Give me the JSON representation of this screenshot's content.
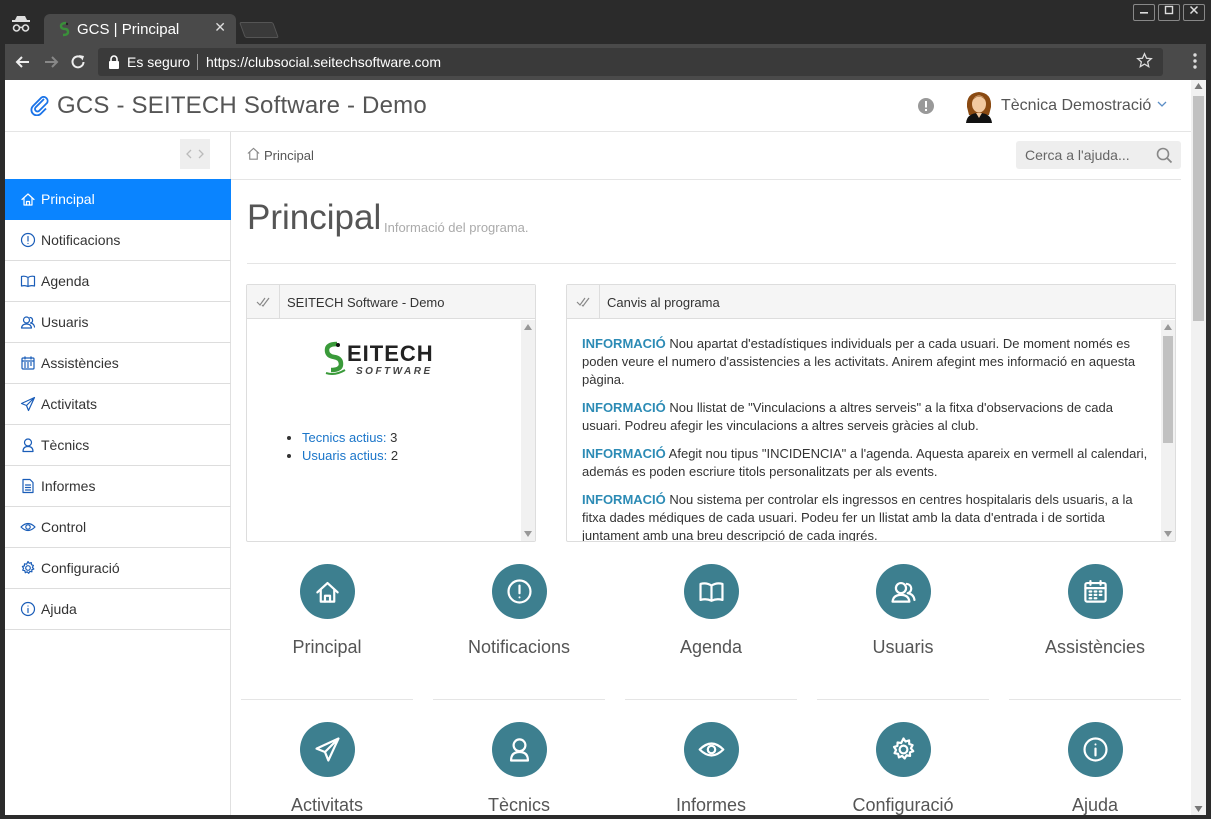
{
  "browser": {
    "tab_title": "GCS | Principal",
    "tab_close": "✕",
    "secure_label": "Es seguro",
    "url": "https://clubsocial.seitechsoftware.com"
  },
  "header": {
    "brand": "GCS - SEITECH Software - Demo",
    "user_name": "Tècnica Demostració"
  },
  "sidebar": {
    "items": [
      {
        "label": "Principal",
        "icon": "home-icon",
        "active": true
      },
      {
        "label": "Notificacions",
        "icon": "alert-icon"
      },
      {
        "label": "Agenda",
        "icon": "book-icon"
      },
      {
        "label": "Usuaris",
        "icon": "users-icon"
      },
      {
        "label": "Assistències",
        "icon": "calendar-icon"
      },
      {
        "label": "Activitats",
        "icon": "send-icon"
      },
      {
        "label": "Tècnics",
        "icon": "user-icon"
      },
      {
        "label": "Informes",
        "icon": "document-icon"
      },
      {
        "label": "Control",
        "icon": "eye-icon"
      },
      {
        "label": "Configuració",
        "icon": "gear-icon"
      },
      {
        "label": "Ajuda",
        "icon": "info-icon"
      }
    ]
  },
  "breadcrumb": {
    "home": "Principal"
  },
  "search": {
    "placeholder": "Cerca a l'ajuda..."
  },
  "main": {
    "title": "Principal",
    "subtitle": "Informació del programa."
  },
  "panel_left": {
    "title": "SEITECH Software - Demo",
    "stats": [
      {
        "label": "Tecnics actius:",
        "value": "3"
      },
      {
        "label": "Usuaris actius:",
        "value": "2"
      }
    ]
  },
  "panel_right": {
    "title": "Canvis al programa",
    "items": [
      {
        "tag": "INFORMACIÓ",
        "text": " Nou apartat d'estadístiques individuals per a cada usuari. De moment només es poden veure el numero d'assistencies a les activitats. Anirem afegint mes informació en aquesta pàgina."
      },
      {
        "tag": "INFORMACIÓ",
        "text": " Nou llistat de \"Vinculacions a altres serveis\" a la fitxa d'observacions de cada usuari. Podreu afegir les vinculacions a altres serveis gràcies al club."
      },
      {
        "tag": "INFORMACIÓ",
        "text": " Afegit nou tipus \"INCIDENCIA\" a l'agenda. Aquesta apareix en vermell al calendari, además es poden escriure titols personalitzats per als events."
      },
      {
        "tag": "INFORMACIÓ",
        "text": " Nou sistema per controlar els ingressos en centres hospitalaris dels usuaris, a la fitxa dades médiques de cada usuari. Podeu fer un llistat amb la data d'entrada i de sortida juntament amb una breu descripció de cada ingrés."
      }
    ]
  },
  "tiles": [
    {
      "label": "Principal",
      "icon": "home-icon"
    },
    {
      "label": "Notificacions",
      "icon": "alert-icon"
    },
    {
      "label": "Agenda",
      "icon": "book-icon"
    },
    {
      "label": "Usuaris",
      "icon": "users-icon"
    },
    {
      "label": "Assistències",
      "icon": "calendar-icon"
    },
    {
      "label": "Activitats",
      "icon": "send-icon"
    },
    {
      "label": "Tècnics",
      "icon": "user-icon"
    },
    {
      "label": "Informes",
      "icon": "eye-icon"
    },
    {
      "label": "Configuració",
      "icon": "gear-icon"
    },
    {
      "label": "Ajuda",
      "icon": "info-icon"
    }
  ],
  "colors": {
    "accent": "#0a84ff",
    "tile_circle": "#3d7f8f",
    "info_tag": "#2c8bb5",
    "link": "#1a75c9"
  }
}
